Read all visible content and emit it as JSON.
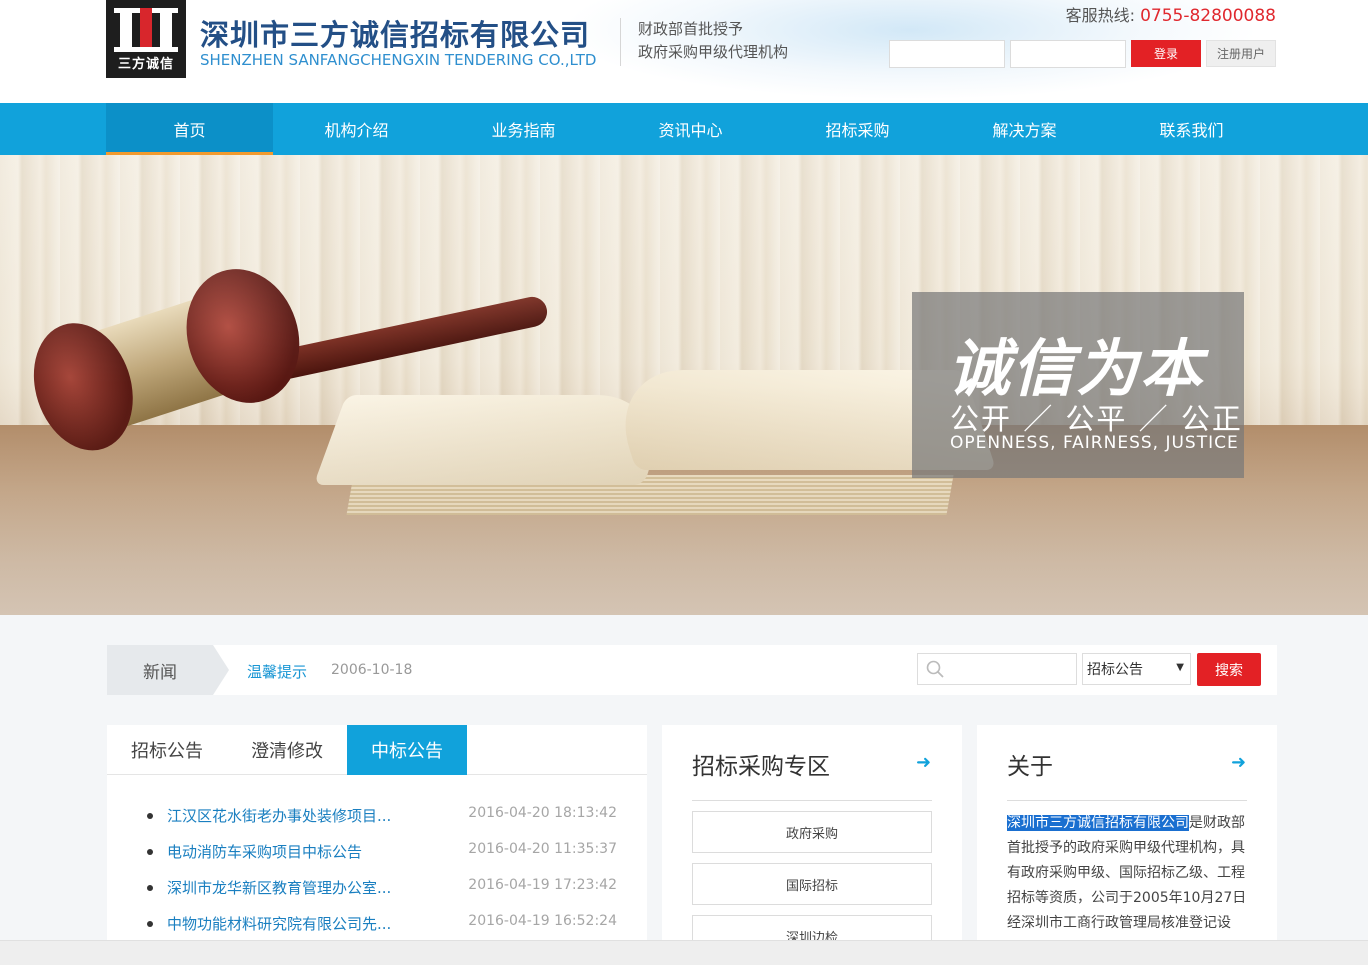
{
  "header": {
    "company_cn": "深圳市三方诚信招标有限公司",
    "company_en": "SHENZHEN SANFANGCHENGXIN TENDERING CO.,LTD",
    "logo_text": "三方诚信",
    "tagline1": "财政部首批授予",
    "tagline2": "政府采购甲级代理机构",
    "hotline_label": "客服热线:",
    "hotline_number": "0755-82800088",
    "login_label": "登录",
    "register_label": "注册用户",
    "username_value": "",
    "password_value": "",
    "brand_red": "#e32125",
    "brand_blue": "#11a2db"
  },
  "nav": {
    "items": [
      {
        "label": "首页",
        "active": true
      },
      {
        "label": "机构介绍"
      },
      {
        "label": "业务指南"
      },
      {
        "label": "资讯中心"
      },
      {
        "label": "招标采购"
      },
      {
        "label": "解决方案"
      },
      {
        "label": "联系我们"
      }
    ]
  },
  "banner": {
    "slogan_main": "诚信为本",
    "slogan_sub": "公开 ／ 公平 ／ 公正",
    "slogan_en": "OPENNESS,  FAIRNESS,  JUSTICE"
  },
  "news": {
    "label": "新闻",
    "title": "温馨提示",
    "date": "2006-10-18",
    "search_value": "",
    "select_value": "招标公告",
    "search_button": "搜索",
    "search_icon": "magnifier-icon"
  },
  "tabs_panel": {
    "tabs": [
      {
        "label": "招标公告"
      },
      {
        "label": "澄清修改"
      },
      {
        "label": "中标公告",
        "active": true
      }
    ],
    "items": [
      {
        "title": "江汉区花水街老办事处装修项目...",
        "date": "2016-04-20 18:13:42"
      },
      {
        "title": "电动消防车采购项目中标公告",
        "date": "2016-04-20 11:35:37"
      },
      {
        "title": "深圳市龙华新区教育管理办公室...",
        "date": "2016-04-19 17:23:42"
      },
      {
        "title": "中物功能材料研究院有限公司先...",
        "date": "2016-04-19 16:52:24"
      }
    ]
  },
  "zone_panel": {
    "title": "招标采购专区",
    "arrow_icon": "arrow-right-icon",
    "buttons": [
      {
        "label": "政府采购"
      },
      {
        "label": "国际招标"
      },
      {
        "label": "深圳边检"
      }
    ]
  },
  "about_panel": {
    "title": "关于",
    "arrow_icon": "arrow-right-icon",
    "highlight": "深圳市三方诚信招标有限公司",
    "text": "是财政部首批授予的政府采购甲级代理机构，具有政府采购甲级、国际招标乙级、工程招标等资质，公司于2005年10月27日经深圳市工商行政管理局核准登记设"
  }
}
